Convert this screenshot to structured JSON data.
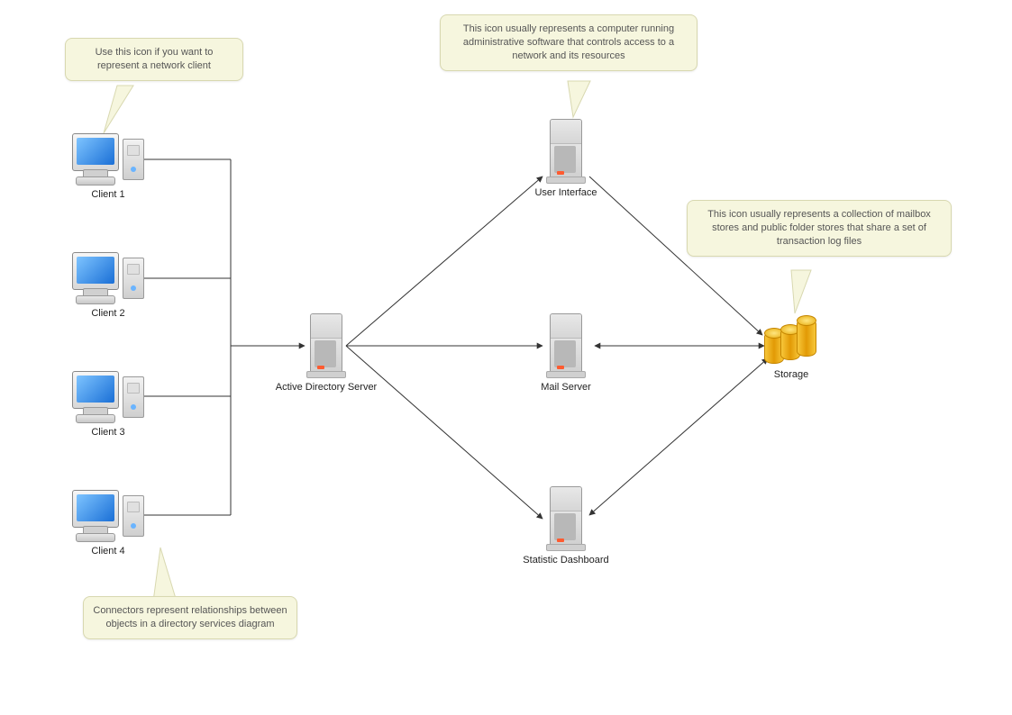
{
  "nodes": {
    "client1": {
      "label": "Client 1"
    },
    "client2": {
      "label": "Client 2"
    },
    "client3": {
      "label": "Client 3"
    },
    "client4": {
      "label": "Client 4"
    },
    "adServer": {
      "label": "Active Directory Server"
    },
    "userInterface": {
      "label": "User Interface"
    },
    "mailServer": {
      "label": "Mail Server"
    },
    "statDashboard": {
      "label": "Statistic Dashboard"
    },
    "storage": {
      "label": "Storage"
    }
  },
  "callouts": {
    "clientTip": "Use this icon if you want to represent a network client",
    "uiTip": "This icon usually represents a computer running administrative software that controls access to a network and its resources",
    "storageTip": "This icon usually represents a collection of mailbox stores and public folder stores that share a set of transaction log files",
    "connectorTip": "Connectors represent relationships between objects in a directory services diagram"
  }
}
